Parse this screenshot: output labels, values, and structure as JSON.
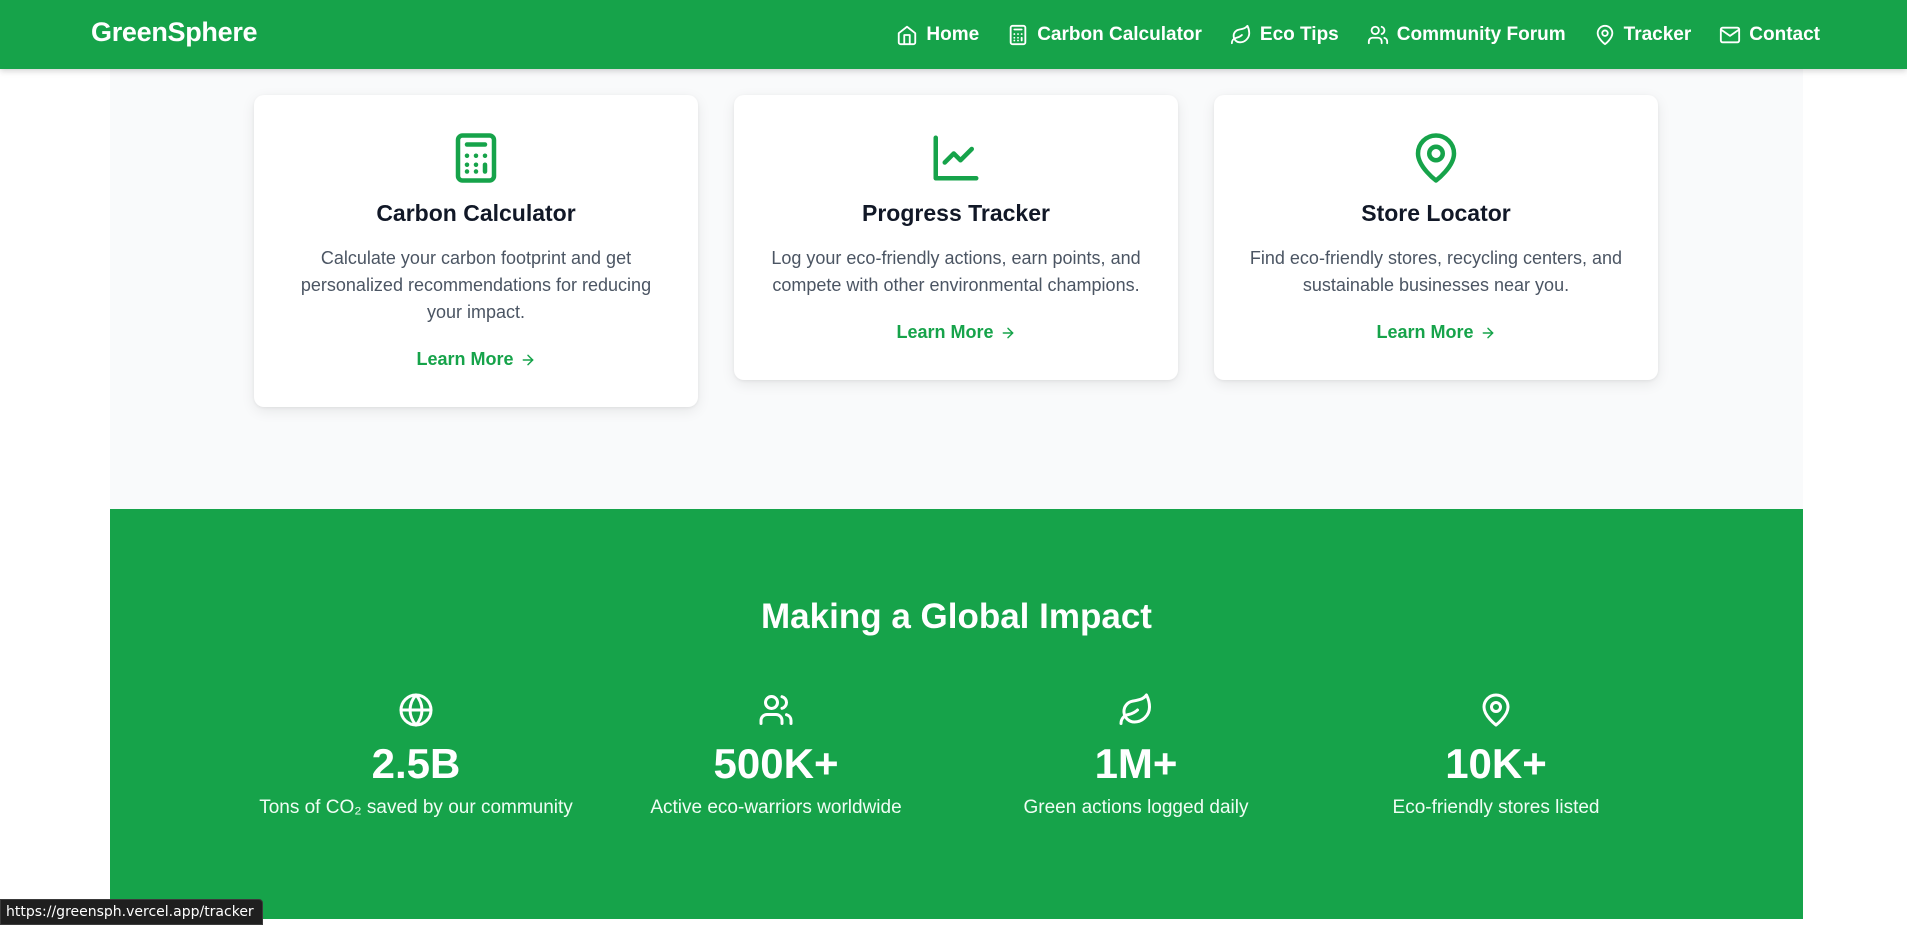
{
  "navbar": {
    "brand": "GreenSphere",
    "links": [
      {
        "label": "Home",
        "icon": "home-icon"
      },
      {
        "label": "Carbon Calculator",
        "icon": "calculator-icon"
      },
      {
        "label": "Eco Tips",
        "icon": "leaf-icon"
      },
      {
        "label": "Community Forum",
        "icon": "users-icon"
      },
      {
        "label": "Tracker",
        "icon": "map-pin-icon"
      },
      {
        "label": "Contact",
        "icon": "mail-icon"
      }
    ]
  },
  "features": {
    "cards": [
      {
        "title": "Carbon Calculator",
        "description": "Calculate your carbon footprint and get personalized recommendations for reducing your impact.",
        "link": "Learn More",
        "icon": "calculator-icon"
      },
      {
        "title": "Progress Tracker",
        "description": "Log your eco-friendly actions, earn points, and compete with other environmental champions.",
        "link": "Learn More",
        "icon": "line-chart-icon"
      },
      {
        "title": "Store Locator",
        "description": "Find eco-friendly stores, recycling centers, and sustainable businesses near you.",
        "link": "Learn More",
        "icon": "map-pin-icon"
      }
    ]
  },
  "impact": {
    "title": "Making a Global Impact",
    "stats": [
      {
        "value": "2.5B",
        "label": "Tons of CO₂ saved by our community",
        "icon": "globe-icon"
      },
      {
        "value": "500K+",
        "label": "Active eco-warriors worldwide",
        "icon": "users-icon"
      },
      {
        "value": "1M+",
        "label": "Green actions logged daily",
        "icon": "leaf-icon"
      },
      {
        "value": "10K+",
        "label": "Eco-friendly stores listed",
        "icon": "map-pin-icon"
      }
    ]
  },
  "status_bar": {
    "url": "https://greensph.vercel.app/tracker"
  },
  "colors": {
    "brand_green": "#16a34a",
    "section_bg": "#f9fafb",
    "text_dark": "#111827",
    "text_muted": "#4b5563"
  }
}
